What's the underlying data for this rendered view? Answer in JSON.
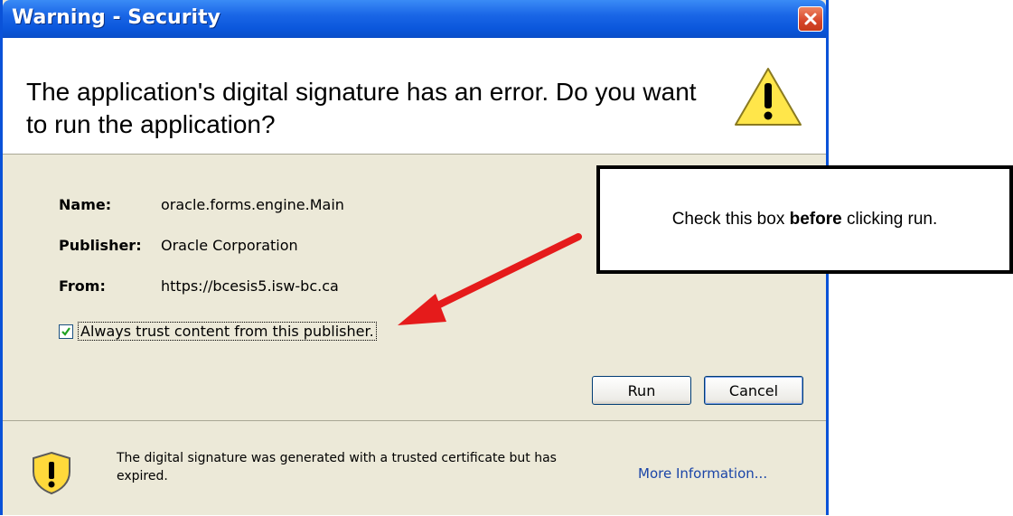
{
  "window": {
    "title": "Warning - Security"
  },
  "header": {
    "message": "The application's digital signature has an error.  Do you want to run the application?"
  },
  "fields": [
    {
      "label": "Name:",
      "value": "oracle.forms.engine.Main"
    },
    {
      "label": "Publisher:",
      "value": "Oracle Corporation"
    },
    {
      "label": "From:",
      "value": "https://bcesis5.isw-bc.ca"
    }
  ],
  "trust_checkbox": {
    "label": "Always trust content from this publisher.",
    "checked": true
  },
  "buttons": {
    "run": "Run",
    "cancel": "Cancel"
  },
  "footer": {
    "message": "The digital signature was generated with a trusted certificate but has expired.",
    "more_info": "More Information..."
  },
  "callout": {
    "prefix": "Check this box ",
    "bold": "before",
    "suffix": " clicking run."
  },
  "icons": {
    "header": "warning-triangle-icon",
    "footer": "shield-warning-icon",
    "close": "close-icon",
    "check": "checkmark-icon"
  },
  "colors": {
    "titlebar": "#0b57dc",
    "dialog_bg": "#ece9d8",
    "arrow": "#e51b1b",
    "link": "#1b45a8"
  }
}
